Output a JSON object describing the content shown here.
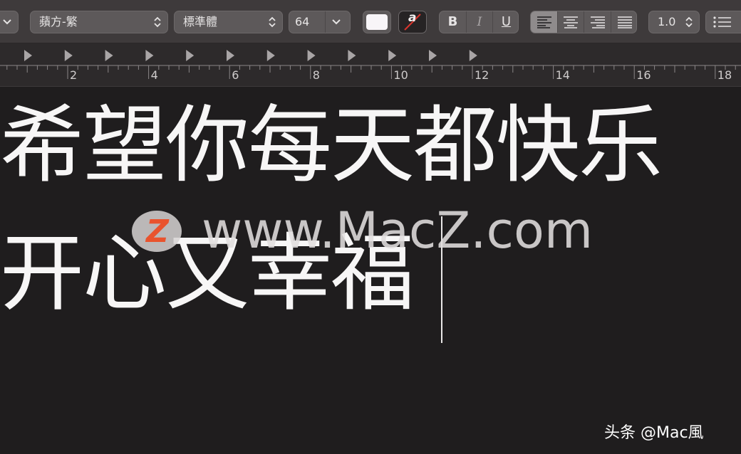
{
  "toolbar": {
    "font_family": "蘋方-繁",
    "font_style": "標準體",
    "font_size": "64",
    "bold_label": "B",
    "italic_label": "I",
    "underline_label": "U",
    "line_spacing": "1.0",
    "text_color": "#f8f5f8",
    "highlight_label": "a",
    "alignment_selected": "left"
  },
  "ruler": {
    "labels": [
      "2",
      "4",
      "6",
      "8",
      "10",
      "12",
      "14",
      "16",
      "18"
    ]
  },
  "document": {
    "line1": "希望你每天都快乐",
    "line2": "开心又幸福"
  },
  "watermark": {
    "logo_letter": "Z",
    "text": "www.MacZ.com",
    "logo_color": "#e9532d"
  },
  "credit": "头条 @Mac風"
}
